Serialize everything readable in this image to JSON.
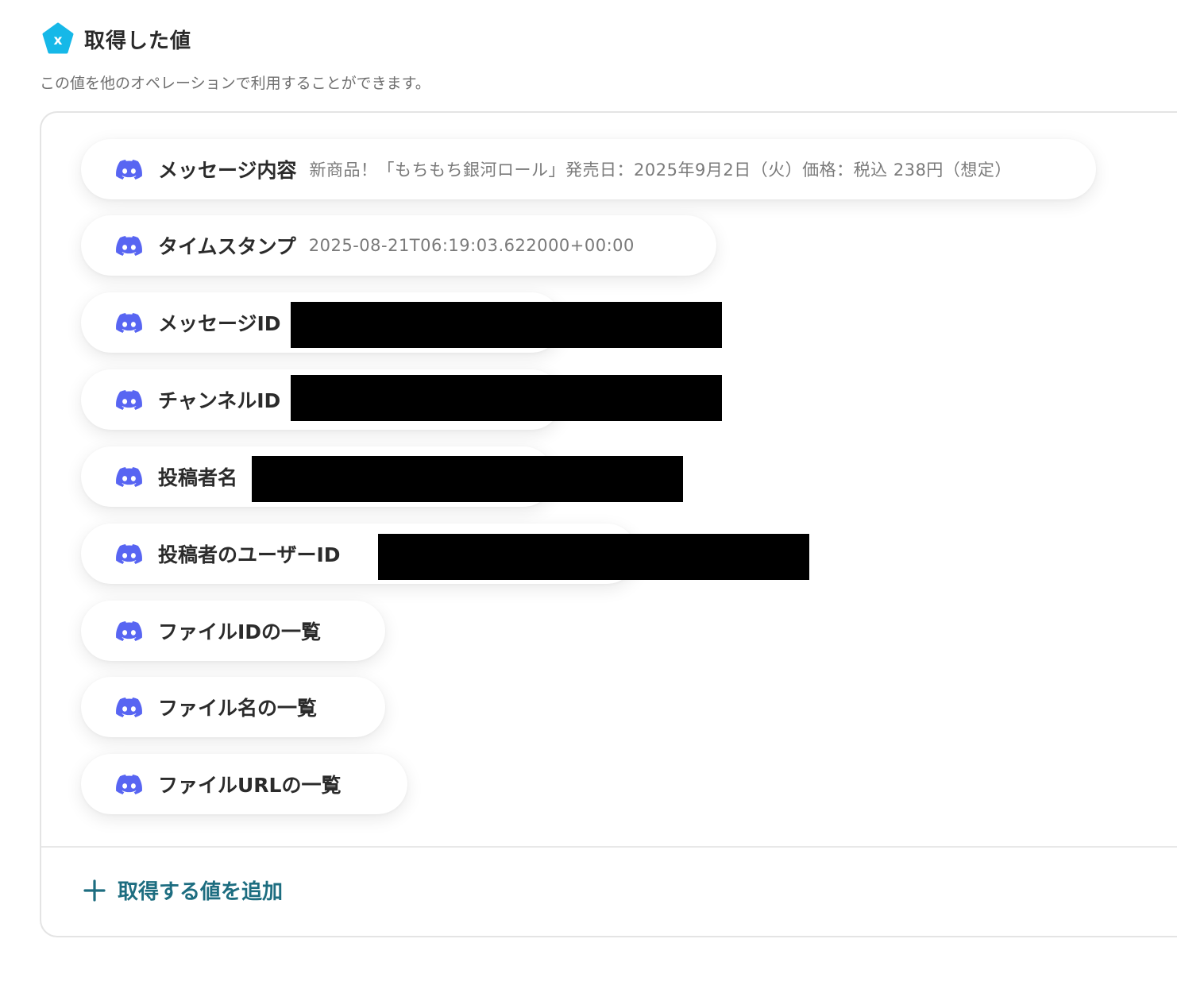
{
  "header": {
    "title": "取得した値",
    "subtitle": "この値を他のオペレーションで利用することができます。"
  },
  "colors": {
    "accent_teal": "#1d6d80",
    "header_icon": "#16b8e8",
    "discord_blurple": "#5865F2"
  },
  "fields": [
    {
      "label": "メッセージ内容",
      "value": "新商品！「もちもち銀河ロール」発売日：2025年9月2日（火）価格：税込 238円（想定）",
      "icon": "discord-icon"
    },
    {
      "label": "タイムスタンプ",
      "value": "2025-08-21T06:19:03.622000+00:00",
      "icon": "discord-icon"
    },
    {
      "label": "メッセージID",
      "value": "",
      "icon": "discord-icon",
      "redacted": true
    },
    {
      "label": "チャンネルID",
      "value": "",
      "icon": "discord-icon",
      "redacted": true
    },
    {
      "label": "投稿者名",
      "value": "",
      "icon": "discord-icon",
      "redacted": true
    },
    {
      "label": "投稿者のユーザーID",
      "value": "",
      "icon": "discord-icon",
      "redacted": true
    },
    {
      "label": "ファイルIDの一覧",
      "value": "",
      "icon": "discord-icon"
    },
    {
      "label": "ファイル名の一覧",
      "value": "",
      "icon": "discord-icon"
    },
    {
      "label": "ファイルURLの一覧",
      "value": "",
      "icon": "discord-icon"
    }
  ],
  "footer": {
    "add_label": "取得する値を追加",
    "add_icon": "plus-icon"
  }
}
